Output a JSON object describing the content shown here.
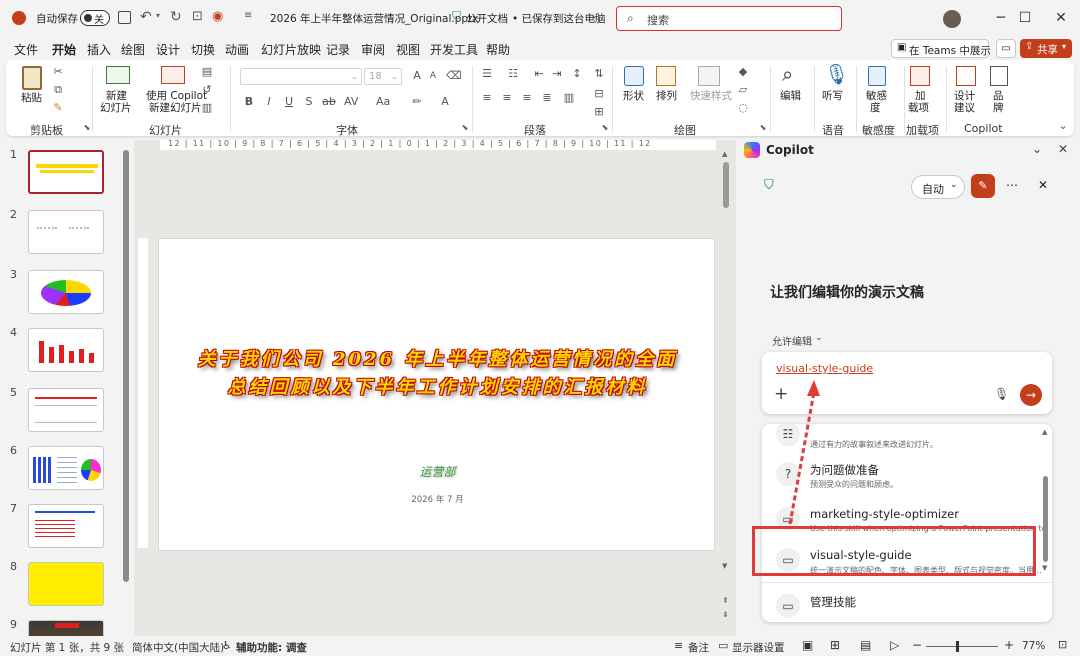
{
  "titlebar": {
    "autosave_label": "自动保存",
    "autosave_state": "关",
    "doc_title": "2026 年上半年整体运营情况_Original.pptx",
    "sensitivity": "公开文档",
    "save_status": "• 已保存到这台电脑",
    "search_placeholder": "搜索"
  },
  "tabs": [
    "文件",
    "开始",
    "插入",
    "绘图",
    "设计",
    "切换",
    "动画",
    "幻灯片放映",
    "记录",
    "审阅",
    "视图",
    "开发工具",
    "帮助"
  ],
  "tabs_right": {
    "teams": "在 Teams 中展示",
    "share": "共享"
  },
  "ribbon": {
    "paste": "粘贴",
    "new_slide": [
      "新建",
      "幻灯片"
    ],
    "copilot_new": [
      "使用 Copilot",
      "新建幻灯片"
    ],
    "font_name": "",
    "font_size": "18",
    "shape": "形状",
    "arrange": "排列",
    "quick_style": "快速样式",
    "edit": "编辑",
    "dictate": "听写",
    "sensitivity": [
      "敏感",
      "度"
    ],
    "addins": [
      "加",
      "载项"
    ],
    "designer": [
      "设计",
      "建议"
    ],
    "brand": [
      "品",
      "牌"
    ],
    "groups": {
      "clipboard": "剪贴板",
      "slides": "幻灯片",
      "font": "字体",
      "paragraph": "段落",
      "drawing": "绘图",
      "voice": "语音",
      "sensitivity": "敏感度",
      "addins": "加载项",
      "copilot": "Copilot"
    }
  },
  "ruler_top": "12 | 11 | 10 | 9 | 8 | 7 | 6 | 5 | 4 | 3 | 2 | 1 | 0 | 1 | 2 | 3 | 4 | 5 | 6 | 7 | 8 | 9 | 10 | 11 | 12",
  "thumbnails": [
    "1",
    "2",
    "3",
    "4",
    "5",
    "6",
    "7",
    "8",
    "9"
  ],
  "slide": {
    "title_line1": "关于我们公司 2026 年上半年整体运营情况的全面",
    "title_line2": "总结回顾以及下半年工作计划安排的汇报材料",
    "department": "运营部",
    "date": "2026 年 7 月"
  },
  "copilot": {
    "header": "Copilot",
    "mode": "自动",
    "heading": "让我们编辑你的演示文稿",
    "permission": "允许编辑",
    "prompt_tag": "visual-style-guide",
    "skills": [
      {
        "title": "",
        "desc": "通过有力的故事叙述来改进幻灯片。"
      },
      {
        "title": "为问题做准备",
        "desc": "预测受众的问题和顾虑。"
      },
      {
        "title": "marketing-style-optimizer",
        "desc": "Use this skill when optimizing a PowerPoint presentation to mat..."
      },
      {
        "title": "visual-style-guide",
        "desc": "统一演示文稿的配色、字体、图表类型、版式与视觉密度。当用..."
      },
      {
        "title": "管理技能",
        "desc": ""
      }
    ]
  },
  "status": {
    "slide_info": "幻灯片 第 1 张，共 9 张",
    "language": "简体中文(中国大陆)",
    "accessibility": "辅助功能: 调查",
    "notes": "备注",
    "display": "显示器设置",
    "zoom": "77%"
  },
  "colors": {
    "accent": "#c43e1c",
    "highlight": "#e03a3a",
    "slide_title": "#ffd700",
    "department": "#3a9a3a"
  }
}
